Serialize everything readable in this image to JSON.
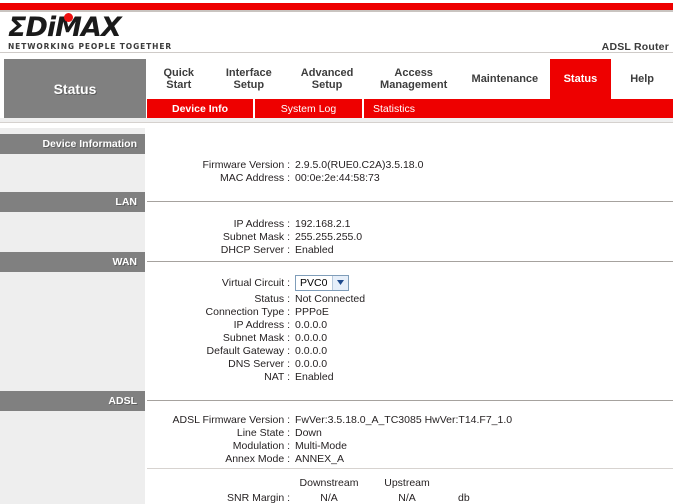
{
  "brand": {
    "logo_text": "ΣDiMAX",
    "logo_tagline": "NETWORKING PEOPLE TOGETHER",
    "model_label": "ADSL Router",
    "accent_red": "#ee0000",
    "panel_gray": "#808080",
    "column_gray": "#eeeeee"
  },
  "sidebar": {
    "active_section": "Status"
  },
  "nav": {
    "items": [
      {
        "label": "Quick\nStart",
        "active": false
      },
      {
        "label": "Interface\nSetup",
        "active": false
      },
      {
        "label": "Advanced\nSetup",
        "active": false
      },
      {
        "label": "Access\nManagement",
        "active": false
      },
      {
        "label": "Maintenance",
        "active": false
      },
      {
        "label": "Status",
        "active": true
      },
      {
        "label": "Help",
        "active": false
      }
    ],
    "subtabs": [
      {
        "label": "Device Info",
        "active": true
      },
      {
        "label": "System Log",
        "active": false
      },
      {
        "label": "Statistics",
        "active": false
      }
    ]
  },
  "sections": {
    "device_information": {
      "heading": "Device Information",
      "rows": [
        {
          "label": "Firmware Version :",
          "value": "2.9.5.0(RUE0.C2A)3.5.18.0"
        },
        {
          "label": "MAC Address :",
          "value": "00:0e:2e:44:58:73"
        }
      ]
    },
    "lan": {
      "heading": "LAN",
      "rows": [
        {
          "label": "IP Address :",
          "value": "192.168.2.1"
        },
        {
          "label": "Subnet Mask :",
          "value": "255.255.255.0"
        },
        {
          "label": "DHCP Server :",
          "value": "Enabled"
        }
      ]
    },
    "wan": {
      "heading": "WAN",
      "virtual_circuit": {
        "label": "Virtual Circuit :",
        "selected": "PVC0"
      },
      "rows": [
        {
          "label": "Status :",
          "value": "Not Connected"
        },
        {
          "label": "Connection Type :",
          "value": "PPPoE"
        },
        {
          "label": "IP Address :",
          "value": "0.0.0.0"
        },
        {
          "label": "Subnet Mask :",
          "value": "0.0.0.0"
        },
        {
          "label": "Default Gateway :",
          "value": "0.0.0.0"
        },
        {
          "label": "DNS Server :",
          "value": "0.0.0.0"
        },
        {
          "label": "NAT :",
          "value": "Enabled"
        }
      ]
    },
    "adsl": {
      "heading": "ADSL",
      "rows": [
        {
          "label": "ADSL Firmware Version :",
          "value": "FwVer:3.5.18.0_A_TC3085 HwVer:T14.F7_1.0"
        },
        {
          "label": "Line State :",
          "value": "Down"
        },
        {
          "label": "Modulation :",
          "value": "Multi-Mode"
        },
        {
          "label": "Annex Mode :",
          "value": "ANNEX_A"
        }
      ],
      "stream_table": {
        "col_downstream": "Downstream",
        "col_upstream": "Upstream",
        "rows": [
          {
            "label": "SNR Margin :",
            "downstream": "N/A",
            "upstream": "N/A",
            "unit": "db"
          }
        ]
      }
    }
  }
}
